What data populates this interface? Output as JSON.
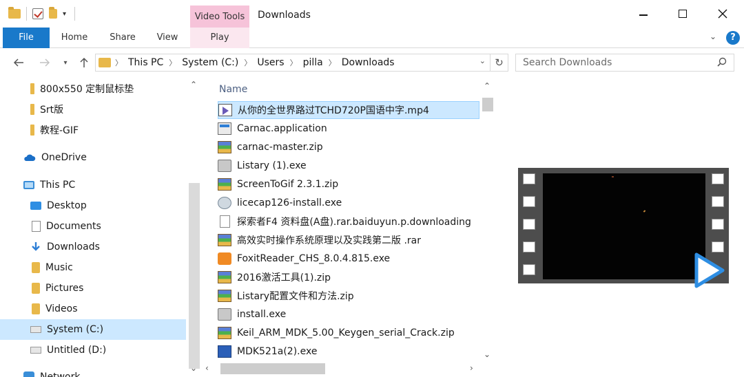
{
  "window": {
    "title": "Downloads",
    "context_tab": "Video Tools"
  },
  "ribbon": {
    "tabs": [
      {
        "label": "File",
        "active": true
      },
      {
        "label": "Home"
      },
      {
        "label": "Share"
      },
      {
        "label": "View"
      },
      {
        "label": "Play"
      }
    ],
    "help": "?"
  },
  "address": {
    "crumbs": [
      "This PC",
      "System (C:)",
      "Users",
      "pilla",
      "Downloads"
    ]
  },
  "search": {
    "placeholder": "Search Downloads"
  },
  "nav_pane": {
    "items": [
      {
        "label": "800x550 定制鼠标垫",
        "icon": "folder-icon"
      },
      {
        "label": "Srt版",
        "icon": "folder-icon"
      },
      {
        "label": "教程-GIF",
        "icon": "folder-icon"
      },
      {
        "label": "OneDrive",
        "icon": "cloud-icon"
      },
      {
        "label": "This PC",
        "icon": "computer-icon"
      },
      {
        "label": "Desktop",
        "icon": "desktop-icon"
      },
      {
        "label": "Documents",
        "icon": "documents-icon"
      },
      {
        "label": "Downloads",
        "icon": "download-arrow-icon"
      },
      {
        "label": "Music",
        "icon": "music-icon"
      },
      {
        "label": "Pictures",
        "icon": "pictures-icon"
      },
      {
        "label": "Videos",
        "icon": "videos-icon"
      },
      {
        "label": "System (C:)",
        "icon": "system-drive-icon",
        "selected": true
      },
      {
        "label": "Untitled (D:)",
        "icon": "drive-icon"
      },
      {
        "label": "Network",
        "icon": "network-icon"
      }
    ]
  },
  "file_list": {
    "column_header": "Name",
    "files": [
      {
        "name": "从你的全世界路过TCHD720P国语中字.mp4",
        "icon": "video-file-icon",
        "selected": true
      },
      {
        "name": "Carnac.application",
        "icon": "application-file-icon"
      },
      {
        "name": "carnac-master.zip",
        "icon": "archive-icon"
      },
      {
        "name": "Listary (1).exe",
        "icon": "installer-icon"
      },
      {
        "name": "ScreenToGif 2.3.1.zip",
        "icon": "archive-icon"
      },
      {
        "name": "licecap126-install.exe",
        "icon": "disc-installer-icon"
      },
      {
        "name": "探索者F4 资料盘(A盘).rar.baiduyun.p.downloading",
        "icon": "blank-file-icon"
      },
      {
        "name": "高效实时操作系统原理以及实践第二版 .rar",
        "icon": "archive-icon"
      },
      {
        "name": "FoxitReader_CHS_8.0.4.815.exe",
        "icon": "foxit-icon"
      },
      {
        "name": "2016激活工具(1).zip",
        "icon": "archive-icon"
      },
      {
        "name": "Listary配置文件和方法.zip",
        "icon": "archive-icon"
      },
      {
        "name": "install.exe",
        "icon": "installer-icon"
      },
      {
        "name": "Keil_ARM_MDK_5.00_Keygen_serial_Crack.zip",
        "icon": "archive-icon"
      },
      {
        "name": "MDK521a(2).exe",
        "icon": "keil-installer-icon"
      }
    ]
  },
  "colors": {
    "accent": "#1979ca",
    "selection": "#cce8ff",
    "context_tab": "#f6c3d9",
    "play_icon": "#2e8ee3"
  }
}
